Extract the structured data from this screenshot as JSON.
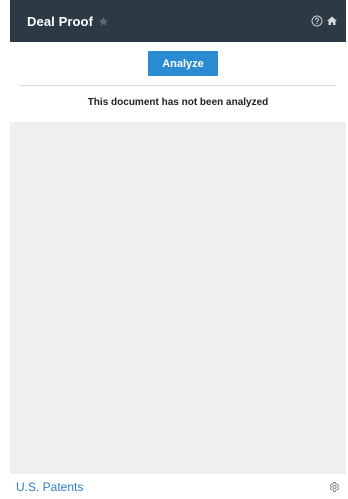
{
  "header": {
    "title": "Deal Proof",
    "star_icon": "star-icon",
    "help_icon": "help-circle-icon",
    "home_icon": "home-icon",
    "background_color": "#2b3a44"
  },
  "analyze": {
    "button_label": "Analyze",
    "status_text": "This document has not been analyzed",
    "accent_color": "#2a8bd1"
  },
  "footer": {
    "link_label": "U.S. Patents",
    "settings_icon": "gear-icon"
  }
}
